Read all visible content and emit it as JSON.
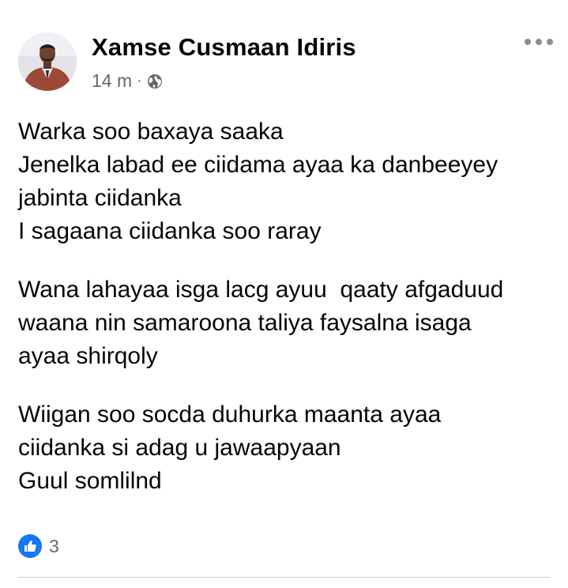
{
  "post": {
    "author": "Xamse Cusmaan Idiris",
    "timestamp": "14 m",
    "separator": "·",
    "audience_icon": "globe-icon",
    "more_icon": "more-options-icon",
    "paragraphs": [
      [
        "Warka soo baxaya saaka",
        "Jenelka labad ee ciidama ayaa ka danbeeyey",
        "jabinta ciidanka",
        "I sagaana ciidanka soo raray"
      ],
      [
        "Wana lahayaa isga lacg ayuu  qaaty afgaduud",
        "waana nin samaroona taliya faysalna isaga",
        "ayaa shirqoly"
      ],
      [
        "Wiigan soo socda duhurka maanta ayaa",
        "ciidanka si adag u jawaapyaan",
        "Guul somlilnd"
      ]
    ],
    "reactions": {
      "icon": "like-icon",
      "count": "3"
    }
  },
  "colors": {
    "name_text": "#050505",
    "meta_text": "#65676b",
    "like_blue": "#1877f2",
    "divider": "#ced0d4"
  }
}
